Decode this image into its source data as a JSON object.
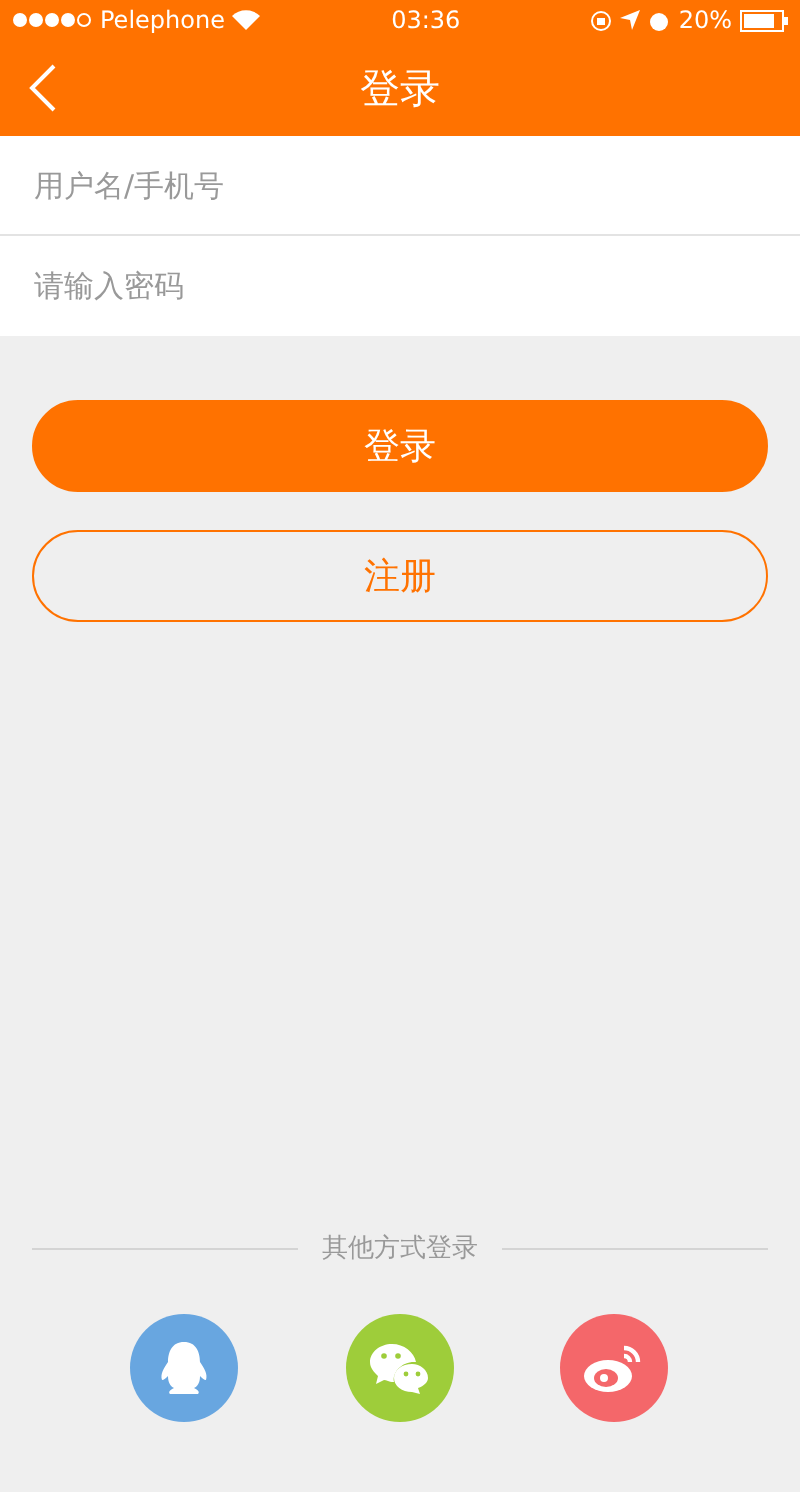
{
  "status_bar": {
    "carrier": "Pelephone",
    "time": "03:36",
    "battery": "20%"
  },
  "nav": {
    "title": "登录"
  },
  "fields": [
    {
      "placeholder": "用户名/手机号"
    },
    {
      "placeholder": "请输入密码"
    }
  ],
  "buttons": [
    {
      "label": "登录",
      "kind": "primary"
    },
    {
      "label": "注册",
      "kind": "outline"
    }
  ],
  "other_login": {
    "label": "其他方式登录",
    "options": [
      {
        "kind": "qq",
        "color": "#68a6e0"
      },
      {
        "kind": "wechat",
        "color": "#9ecd3a"
      },
      {
        "kind": "weibo",
        "color": "#f4676a"
      }
    ]
  }
}
